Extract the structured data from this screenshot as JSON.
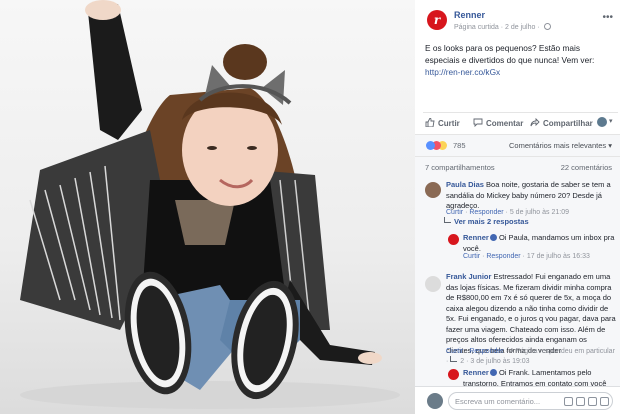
{
  "post": {
    "page_name": "Renner",
    "page_initial": "r",
    "meta_label": "Página curtida",
    "date": "2 de julho",
    "text": "E os looks para os pequenos? Estão mais especiais e divertidos do que nunca! Vem ver: ",
    "link": "http://ren-ner.co/kGx"
  },
  "actions": {
    "like": "Curtir",
    "comment": "Comentar",
    "share": "Compartilhar"
  },
  "reactions": {
    "count": "785",
    "sort_label": "Comentários mais relevantes ▾"
  },
  "stats": {
    "shares": "7 compartilhamentos",
    "comments": "22 comentários"
  },
  "comments": [
    {
      "name": "Paula Dias",
      "text": "Boa noite, gostaria de saber se tem a sandália do Mickey baby número 20? Desde já agradeço.",
      "like": "Curtir",
      "reply": "Responder",
      "time": "5 de julho às 21:09",
      "see_more": "Ver mais 2 respostas",
      "reply_item": {
        "name": "Renner",
        "text": "Oi Paula, mandamos um inbox pra você.",
        "like": "Curtir",
        "reply": "Responder",
        "time": "17 de julho às 16:33"
      }
    },
    {
      "name": "Frank Junior",
      "text": "Estressado! Fui enganado em uma das lojas físicas. Me fizeram dividir minha compra de R$800,00 em 7x é só querer de 5x, a moça do caixa alegou dizendo a não tinha como dividir de 5x. Fui enganado, e o juros q vou pagar, dava para fazer uma viagem. Chateado com isso. Além de preços altos oferecidos ainda enganam os clientes, que bela forma de vender",
      "like": "Curtir",
      "reply": "Responder",
      "time_prefix": "A Página respondeu em particular",
      "replies_count": "2",
      "time": "3 de julho às 19:03",
      "reply_item": {
        "name": "Renner",
        "text": "Oi Frank. Lamentamos pelo transtorno. Entramos em contato com você"
      }
    }
  ],
  "composer": {
    "placeholder": "Escreva um comentário..."
  },
  "colors": {
    "brand": "#d7161d",
    "link": "#365899"
  }
}
